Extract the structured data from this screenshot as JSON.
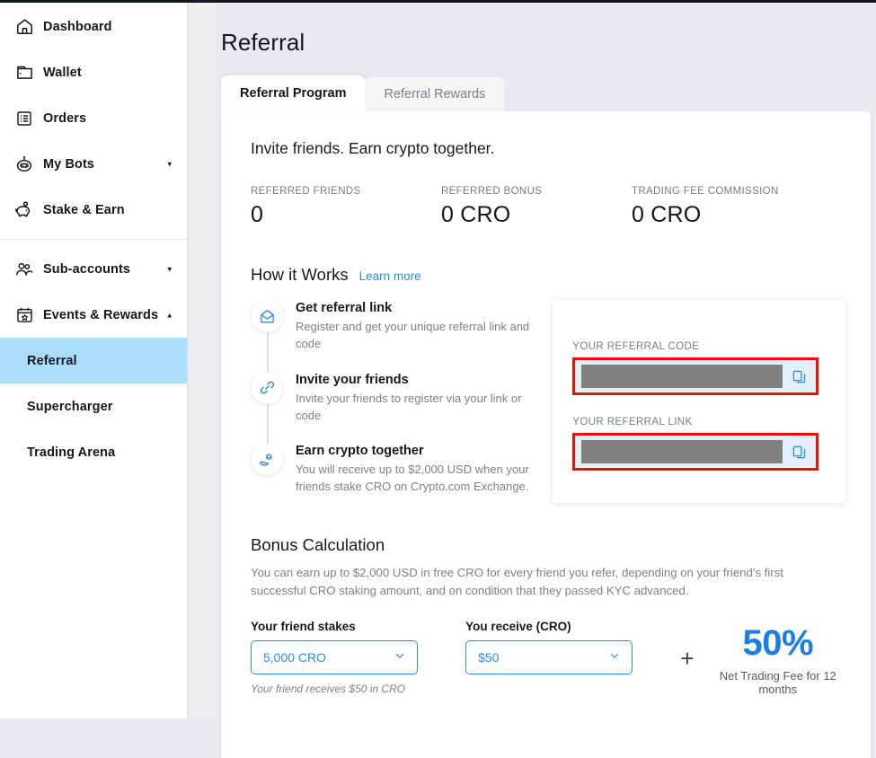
{
  "colors": {
    "accent_blue": "#2b8ae8",
    "pct_blue": "#1b7ee8",
    "active_nav_bg": "#abdcfa",
    "highlight_red": "#f60b00",
    "page_bg": "#e8eaf1",
    "redaction_gray": "#808080"
  },
  "sidebar": {
    "primary_items": [
      {
        "label": "Dashboard",
        "icon": "home-icon",
        "caret": null
      },
      {
        "label": "Wallet",
        "icon": "wallet-icon",
        "caret": null
      },
      {
        "label": "Orders",
        "icon": "orders-list-icon",
        "caret": null
      },
      {
        "label": "My Bots",
        "icon": "robot-icon",
        "caret": "▾"
      },
      {
        "label": "Stake & Earn",
        "icon": "piggy-bank-icon",
        "caret": null
      }
    ],
    "secondary_items": [
      {
        "label": "Sub-accounts",
        "icon": "users-icon",
        "caret": "▾"
      },
      {
        "label": "Events & Rewards",
        "icon": "calendar-star-icon",
        "caret": "▴"
      }
    ],
    "sub_items": [
      {
        "label": "Referral",
        "active": true
      },
      {
        "label": "Supercharger",
        "active": false
      },
      {
        "label": "Trading Arena",
        "active": false
      }
    ]
  },
  "page": {
    "title": "Referral"
  },
  "tabs": [
    {
      "label": "Referral Program",
      "active": true
    },
    {
      "label": "Referral Rewards",
      "active": false
    }
  ],
  "hero": {
    "headline": "Invite friends. Earn crypto together."
  },
  "stats": [
    {
      "label": "REFERRED FRIENDS",
      "value": "0"
    },
    {
      "label": "REFERRED BONUS",
      "value": "0 CRO"
    },
    {
      "label": "TRADING FEE COMMISSION",
      "value": "0 CRO"
    }
  ],
  "how_it_works": {
    "title": "How it Works",
    "learn_more": "Learn more",
    "steps": [
      {
        "icon": "mail-envelope-icon",
        "title": "Get referral link",
        "desc": "Register and get your unique referral link and code"
      },
      {
        "icon": "chain-link-icon",
        "title": "Invite your friends",
        "desc": "Invite your friends to register via your link or code"
      },
      {
        "icon": "hand-coins-icon",
        "title": "Earn crypto together",
        "desc": "You will receive up to $2,000 USD when your friends stake CRO on Crypto.com Exchange."
      }
    ]
  },
  "referral_panel": {
    "code_label": "YOUR REFERRAL CODE",
    "code_value": "",
    "link_label": "YOUR REFERRAL LINK",
    "link_value": "",
    "copy_icon": "copy-icon",
    "redacted": true
  },
  "bonus": {
    "title": "Bonus Calculation",
    "desc": "You can earn up to $2,000 USD in free CRO for every friend you refer, depending on your friend's first successful CRO staking amount, and on condition that they passed KYC advanced.",
    "stake_label": "Your friend stakes",
    "stake_value": "5,000 CRO",
    "receive_label": "You receive (CRO)",
    "receive_value": "$50",
    "note": "Your friend receives $50 in CRO",
    "plus_sign": "+",
    "percent": "50%",
    "percent_sub": "Net Trading Fee for 12 months"
  }
}
